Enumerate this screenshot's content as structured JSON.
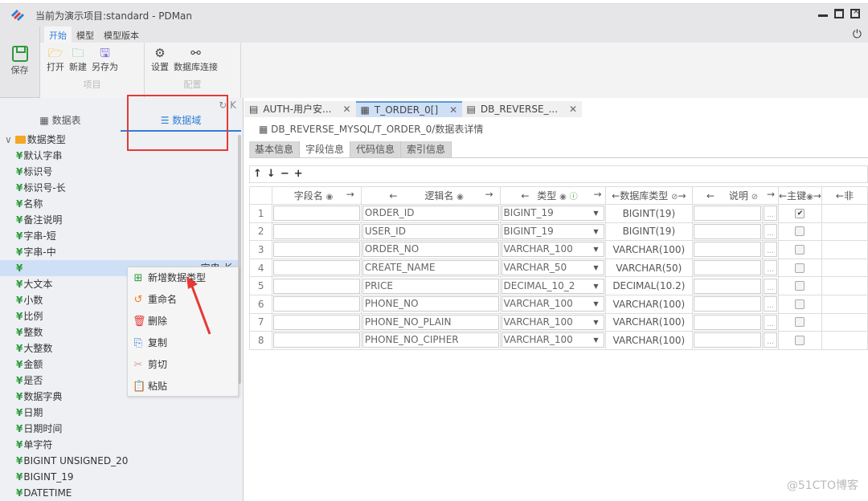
{
  "window": {
    "title": "当前为演示项目:standard - PDMan",
    "controls": [
      "minimize",
      "maximize",
      "close"
    ]
  },
  "ribbon": {
    "save_label": "保存",
    "tabs": [
      {
        "label": "开始",
        "active": true
      },
      {
        "label": "模型",
        "active": false
      },
      {
        "label": "模型版本",
        "active": false
      }
    ],
    "groups": [
      {
        "name": "项目",
        "buttons": [
          {
            "label": "打开",
            "icon": "folder-open-icon"
          },
          {
            "label": "新建",
            "icon": "folder-add-icon"
          },
          {
            "label": "另存为",
            "icon": "save-as-icon"
          }
        ]
      },
      {
        "name": "配置",
        "buttons": [
          {
            "label": "设置",
            "icon": "gear-icon"
          },
          {
            "label": "数据库连接",
            "icon": "link-icon"
          }
        ]
      }
    ]
  },
  "left_panel": {
    "tabs": [
      {
        "label": "数据表",
        "icon": "grid-icon",
        "active": false
      },
      {
        "label": "数据域",
        "icon": "list-icon",
        "active": true
      }
    ],
    "root": "数据类型",
    "items": [
      "默认字串",
      "标识号",
      "标识号-长",
      "名称",
      "备注说明",
      "字串-短",
      "字串-中",
      "字串-长",
      "大文本",
      "小数",
      "比例",
      "整数",
      "大整数",
      "金额",
      "是否",
      "数据字典",
      "日期",
      "日期时间",
      "单字符",
      "BIGINT UNSIGNED_20",
      "BIGINT_19",
      "DATETIME"
    ],
    "selected_index": 7
  },
  "context_menu": {
    "items": [
      {
        "label": "新增数据类型",
        "icon": "folder-add-icon",
        "color": "#2e9a3c"
      },
      {
        "label": "重命名",
        "icon": "rename-icon",
        "color": "#f57c20"
      },
      {
        "label": "删除",
        "icon": "trash-icon",
        "color": "#e53935"
      },
      {
        "label": "复制",
        "icon": "copy-icon",
        "color": "#2f7ed8"
      },
      {
        "label": "剪切",
        "icon": "scissors-icon",
        "color": "#d9a0a0"
      },
      {
        "label": "粘贴",
        "icon": "paste-icon",
        "color": "#4a5ed8"
      }
    ]
  },
  "doc_tabs": [
    {
      "label": "AUTH-用户安...",
      "active": false
    },
    {
      "label": "T_ORDER_0[]",
      "active": true
    },
    {
      "label": "DB_REVERSE_...",
      "active": false
    }
  ],
  "breadcrumb": "DB_REVERSE_MYSQL/T_ORDER_0/数据表详情",
  "sub_tabs": [
    {
      "label": "基本信息",
      "active": false
    },
    {
      "label": "字段信息",
      "active": true
    },
    {
      "label": "代码信息",
      "active": false
    },
    {
      "label": "索引信息",
      "active": false
    }
  ],
  "toolbar": {
    "up": "↑",
    "down": "↓",
    "remove": "−",
    "add": "+"
  },
  "table": {
    "headers": [
      "",
      "字段名",
      "逻辑名",
      "类型",
      "数据库类型",
      "说明",
      "主键",
      "←非"
    ],
    "rows": [
      {
        "n": "1",
        "field": "",
        "logic": "ORDER_ID",
        "type": "BIGINT_19",
        "db": "BIGINT(19)",
        "desc": "",
        "pk": true
      },
      {
        "n": "2",
        "field": "",
        "logic": "USER_ID",
        "type": "BIGINT_19",
        "db": "BIGINT(19)",
        "desc": "",
        "pk": false
      },
      {
        "n": "3",
        "field": "",
        "logic": "ORDER_NO",
        "type": "VARCHAR_100",
        "db": "VARCHAR(100)",
        "desc": "",
        "pk": false
      },
      {
        "n": "4",
        "field": "",
        "logic": "CREATE_NAME",
        "type": "VARCHAR_50",
        "db": "VARCHAR(50)",
        "desc": "",
        "pk": false
      },
      {
        "n": "5",
        "field": "",
        "logic": "PRICE",
        "type": "DECIMAL_10_2",
        "db": "DECIMAL(10.2)",
        "desc": "",
        "pk": false
      },
      {
        "n": "6",
        "field": "",
        "logic": "PHONE_NO",
        "type": "VARCHAR_100",
        "db": "VARCHAR(100)",
        "desc": "",
        "pk": false
      },
      {
        "n": "7",
        "field": "",
        "logic": "PHONE_NO_PLAIN",
        "type": "VARCHAR_100",
        "db": "VARCHAR(100)",
        "desc": "",
        "pk": false
      },
      {
        "n": "8",
        "field": "",
        "logic": "PHONE_NO_CIPHER",
        "type": "VARCHAR_100",
        "db": "VARCHAR(100)",
        "desc": "",
        "pk": false
      }
    ]
  },
  "watermark": "@51CTO博客",
  "colors": {
    "accent": "#2f7ed8",
    "highlight": "#e53935",
    "green": "#2e9a3c"
  }
}
